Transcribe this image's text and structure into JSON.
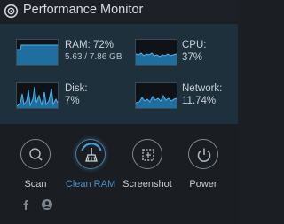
{
  "window": {
    "title": "Performance Monitor"
  },
  "stats": [
    {
      "name": "ram",
      "label": "RAM: 72%",
      "detail": "5.63 / 7.86 GB"
    },
    {
      "name": "cpu",
      "label": "CPU:",
      "detail": "37%"
    },
    {
      "name": "disk",
      "label": "Disk:",
      "detail": "7%"
    },
    {
      "name": "network",
      "label": "Network:",
      "detail": "11.74%"
    }
  ],
  "actions": [
    {
      "name": "scan",
      "label": "Scan",
      "icon": "magnifier-icon",
      "active": false
    },
    {
      "name": "clean-ram",
      "label": "Clean RAM",
      "icon": "broom-icon",
      "active": true
    },
    {
      "name": "screenshot",
      "label": "Screenshot",
      "icon": "screenshot-icon",
      "active": false
    },
    {
      "name": "power",
      "label": "Power",
      "icon": "power-icon",
      "active": false
    }
  ],
  "social": [
    {
      "name": "facebook",
      "icon": "facebook-icon"
    },
    {
      "name": "user",
      "icon": "user-icon"
    }
  ],
  "colors": {
    "accent": "#4f8fc2",
    "panel": "#1f303d",
    "graph_line": "#3fa7e6"
  }
}
